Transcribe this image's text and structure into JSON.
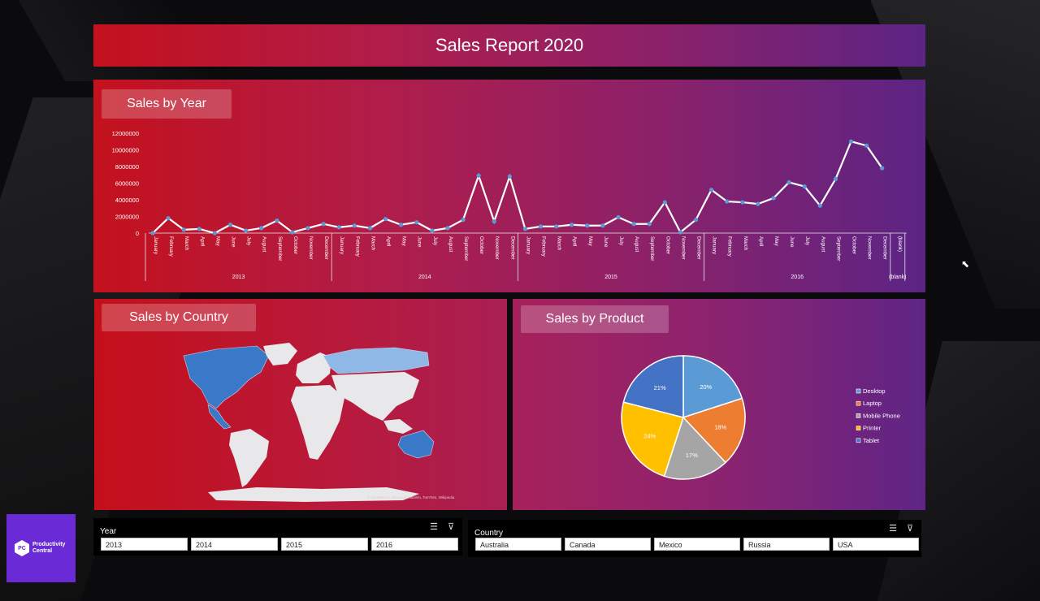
{
  "header": {
    "title": "Sales Report 2020"
  },
  "sales_by_year": {
    "title": "Sales by Year",
    "years": [
      "2013",
      "2014",
      "2015",
      "2016"
    ],
    "months": [
      "January",
      "February",
      "March",
      "April",
      "May",
      "June",
      "July",
      "August",
      "September",
      "October",
      "November",
      "December"
    ],
    "blank_label": "(blank)",
    "blank_year": "(blank)"
  },
  "sales_by_country": {
    "title": "Sales by Country",
    "credit": "© GeoNames, Microsoft, Navinfo, TomTom, Wikipedia"
  },
  "sales_by_product": {
    "title": "Sales by Product"
  },
  "slicers": {
    "year": {
      "label": "Year",
      "options": [
        "2013",
        "2014",
        "2015",
        "2016"
      ]
    },
    "country": {
      "label": "Country",
      "options": [
        "Australia",
        "Canada",
        "Mexico",
        "Russia",
        "USA"
      ]
    }
  },
  "logo": {
    "line1": "Productivity",
    "line2": "Central"
  },
  "colors": {
    "line": "#ffffff",
    "marker": "#5b9bd5",
    "map_highlight": "#3a78c8",
    "map_light": "#8fb8e6",
    "map_land": "#e8e8ea"
  },
  "chart_data": [
    {
      "type": "line",
      "title": "Sales by Year",
      "ylim": [
        0,
        12000000
      ],
      "yticks": [
        0,
        2000000,
        4000000,
        6000000,
        8000000,
        10000000,
        12000000
      ],
      "x_groups": [
        "2013",
        "2014",
        "2015",
        "2016",
        "(blank)"
      ],
      "values": [
        0,
        1800000,
        400000,
        500000,
        0,
        1000000,
        300000,
        600000,
        1500000,
        100000,
        600000,
        1100000,
        700000,
        900000,
        600000,
        1700000,
        1000000,
        1300000,
        300000,
        600000,
        1600000,
        6900000,
        1400000,
        6800000,
        500000,
        800000,
        800000,
        1000000,
        900000,
        900000,
        1900000,
        1100000,
        1100000,
        3700000,
        100000,
        1600000,
        5200000,
        3800000,
        3700000,
        3500000,
        4200000,
        6100000,
        5600000,
        3300000,
        6500000,
        11000000,
        10500000,
        7800000
      ]
    },
    {
      "type": "pie",
      "title": "Sales by Product",
      "categories": [
        "Desktop",
        "Laptop",
        "Mobile Phone",
        "Printer",
        "Tablet"
      ],
      "values": [
        20,
        18,
        17,
        24,
        21
      ],
      "labels": [
        "20%",
        "18%",
        "17%",
        "24%",
        "21%"
      ],
      "colors": [
        "#5b9bd5",
        "#ed7d31",
        "#a5a5a5",
        "#ffc000",
        "#4472c4"
      ],
      "legend": "right"
    }
  ]
}
